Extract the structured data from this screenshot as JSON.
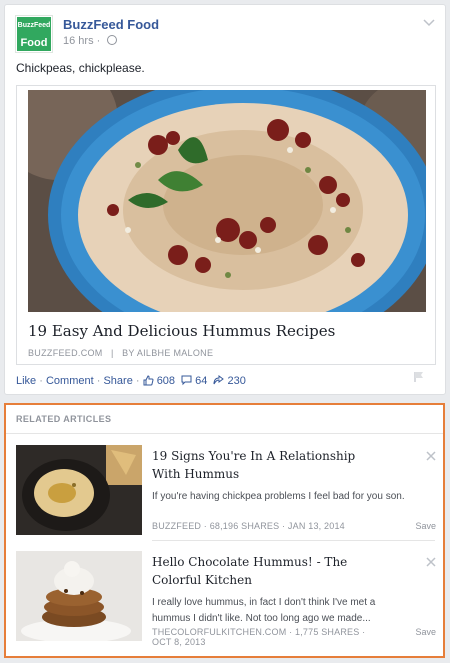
{
  "post": {
    "page_name": "BuzzFeed Food",
    "logo_top": "BuzzFeed",
    "logo_bottom": "Food",
    "time": "16 hrs",
    "message": "Chickpeas, chickplease.",
    "link": {
      "title": "19 Easy And Delicious Hummus Recipes",
      "domain": "BUZZFEED.COM",
      "author": "BY AILBHE MALONE"
    },
    "actions": {
      "like": "Like",
      "comment": "Comment",
      "share": "Share",
      "likes_count": "608",
      "comments_count": "64",
      "shares_count": "230"
    }
  },
  "related": {
    "header": "RELATED ARTICLES",
    "articles": [
      {
        "title": "19 Signs You're In A Relationship With Hummus",
        "description": "If you're having chickpea problems I feel bad for you son.",
        "source": "BUZZFEED · 68,196 SHARES · JAN 13, 2014",
        "save": "Save"
      },
      {
        "title": "Hello Chocolate Hummus! - The Colorful Kitchen",
        "description": "I really love hummus, in fact I don't think I've met a hummus I didn't like. Not too long ago we made...",
        "source_line1": "THECOLORFULKITCHEN.COM · 1,775 SHARES ·",
        "source_line2": "OCT 8, 2013",
        "save": "Save"
      }
    ]
  },
  "colors": {
    "accent": "#e67e3a",
    "link_blue": "#365899",
    "brand_green": "#31a85f"
  }
}
